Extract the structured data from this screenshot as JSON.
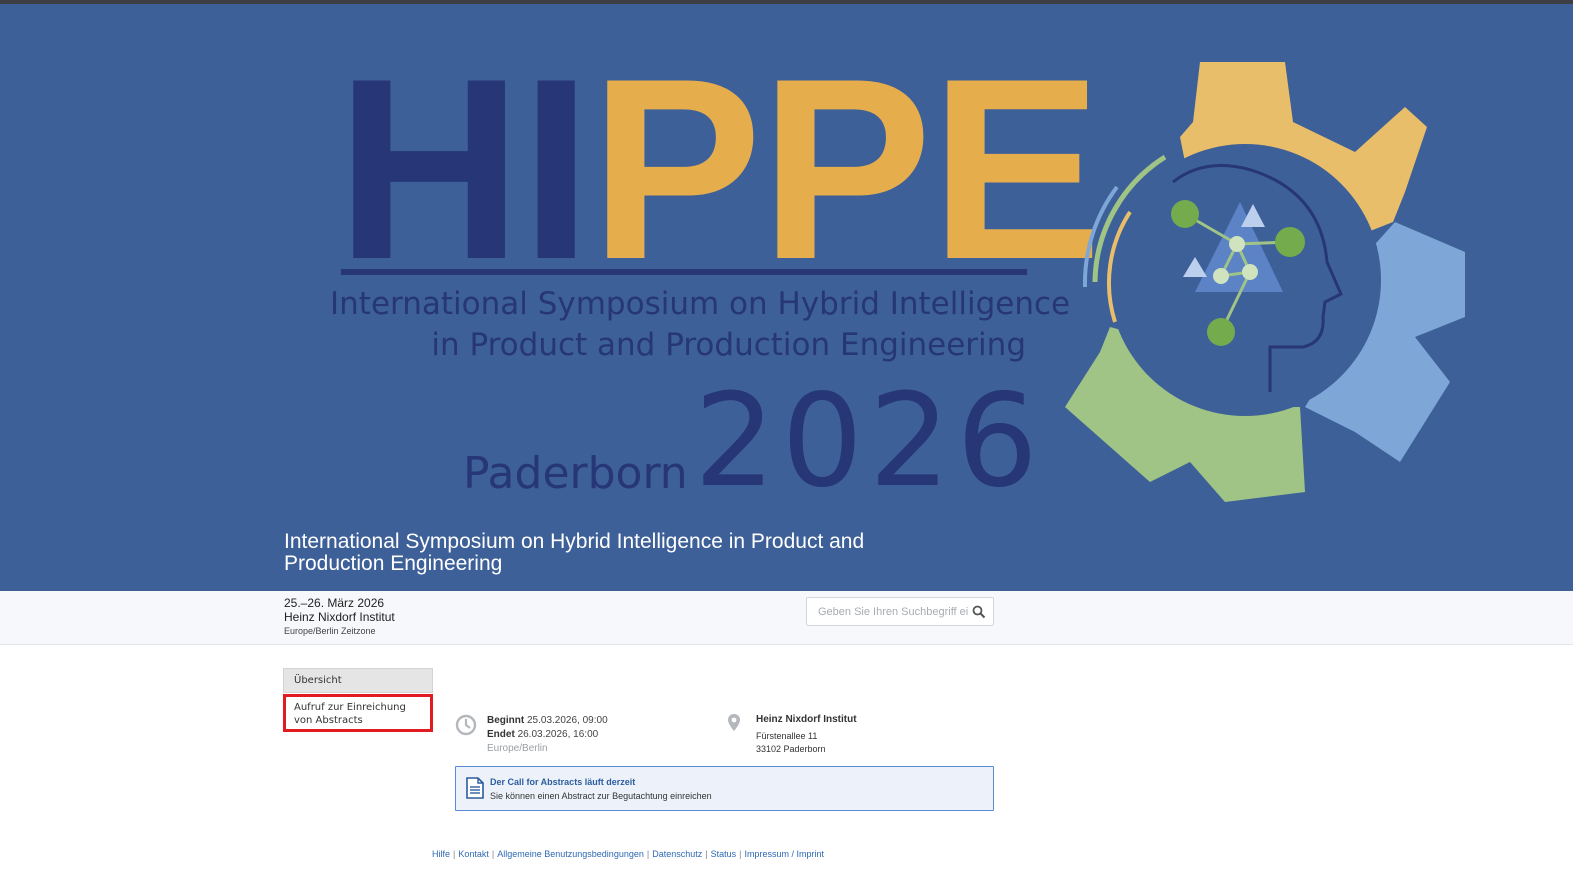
{
  "banner": {
    "logo": {
      "hi": "HI",
      "ppe": "PPE",
      "subtitle_line1": "International Symposium on Hybrid Intelligence",
      "subtitle_line2": "in Product and Production Engineering",
      "city": "Paderborn",
      "year": "2026"
    },
    "title": "International Symposium on Hybrid Intelligence in Product and Production Engineering",
    "colors": {
      "background": "#3e6098",
      "navy": "#263677",
      "gold": "#e6ad4c",
      "light_blue": "#7ea7d8",
      "green": "#9fc485"
    }
  },
  "event_info": {
    "dates": "25.–26. März 2026",
    "venue": "Heinz Nixdorf Institut",
    "timezone": "Europe/Berlin Zeitzone"
  },
  "search": {
    "placeholder": "Geben Sie Ihren Suchbegriff ein",
    "icon": "search-icon"
  },
  "nav": {
    "items": [
      {
        "label": "Übersicht",
        "active": true
      },
      {
        "label": "Aufruf zur Einreichung von Abstracts",
        "highlighted": true
      }
    ]
  },
  "schedule": {
    "icon": "clock-icon",
    "begins_label": "Beginnt",
    "begins_value": "25.03.2026, 09:00",
    "ends_label": "Endet",
    "ends_value": "26.03.2026, 16:00",
    "timezone": "Europe/Berlin"
  },
  "location": {
    "icon": "map-pin-icon",
    "name": "Heinz Nixdorf Institut",
    "street": "Fürstenallee 11",
    "city": "33102 Paderborn"
  },
  "call_for_abstracts": {
    "icon": "document-icon",
    "title": "Der Call for Abstracts läuft derzeit",
    "text": "Sie können einen Abstract zur Begutachtung einreichen",
    "colors": {
      "border": "#5b8bd0",
      "background": "#edf2fa"
    }
  },
  "footer": {
    "links": [
      "Hilfe",
      "Kontakt",
      "Allgemeine Benutzungsbedingungen",
      "Datenschutz",
      "Status",
      "Impressum / Imprint"
    ],
    "separator": "|"
  }
}
